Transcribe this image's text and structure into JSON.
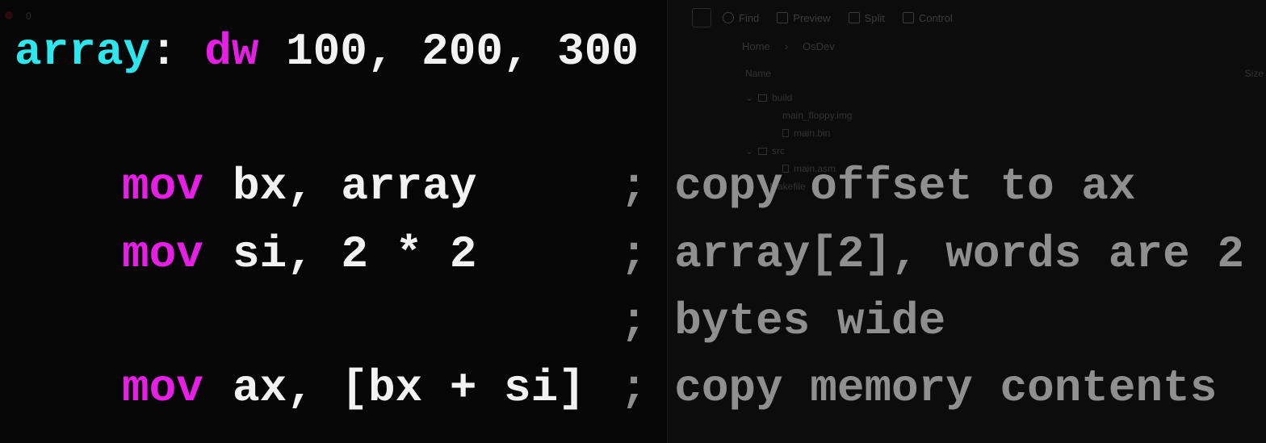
{
  "background_app": {
    "tab_indicator": "0",
    "toolbar": [
      {
        "icon": "search-icon",
        "label": "Find"
      },
      {
        "icon": "image-icon",
        "label": "Preview"
      },
      {
        "icon": "split-icon",
        "label": "Split"
      },
      {
        "icon": "menu-icon",
        "label": "Control"
      }
    ],
    "breadcrumb": [
      "Home",
      "OsDev"
    ],
    "columns": {
      "name": "Name",
      "size": "Size"
    },
    "tree": [
      {
        "label": "build",
        "type": "folder",
        "level": 0
      },
      {
        "label": "main_floppy.img",
        "type": "file",
        "level": 1
      },
      {
        "label": "main.bin",
        "type": "file",
        "level": 1
      },
      {
        "label": "src",
        "type": "folder",
        "level": 0
      },
      {
        "label": "main.asm",
        "type": "file",
        "level": 1
      },
      {
        "label": "Makefile",
        "type": "file",
        "level": 0
      }
    ]
  },
  "code": {
    "line1": {
      "label": "array",
      "colon": ":",
      "directive": "dw",
      "values": "100, 200, 300"
    },
    "instructions": [
      {
        "op": "mov",
        "operands": "bx, array",
        "comment": "; copy offset to ax"
      },
      {
        "op": "mov",
        "operands": "si, 2 * 2",
        "comment": "; array[2], words are 2"
      },
      {
        "op": "",
        "operands": "",
        "comment": "; bytes wide"
      },
      {
        "op": "mov",
        "operands": "ax, [bx + si]",
        "comment": "; copy memory contents"
      }
    ]
  },
  "colors": {
    "label": "#2ee6ee",
    "keyword": "#e61ee6",
    "text": "#f2f2f2",
    "comment": "#8f8f8f",
    "background": "#060606"
  }
}
